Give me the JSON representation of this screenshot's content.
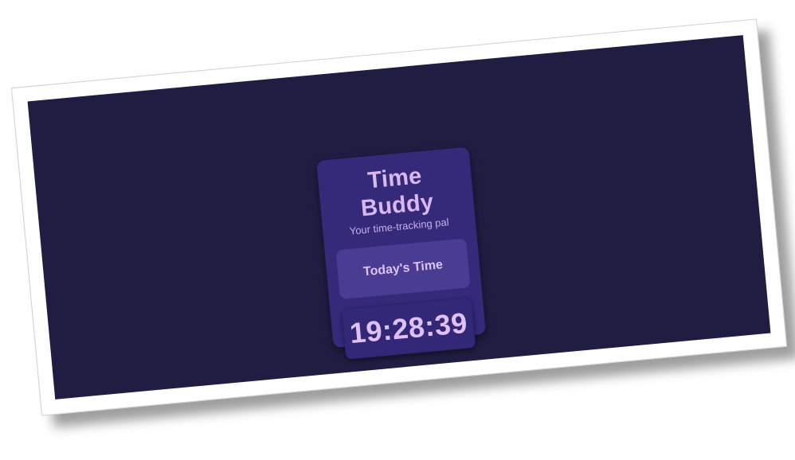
{
  "app": {
    "title": "Time Buddy",
    "subtitle": "Your time-tracking pal"
  },
  "today_section": {
    "label": "Today's Time"
  },
  "clock": {
    "time": "19:28:39"
  },
  "colors": {
    "background": "#1f1d42",
    "card": "#35297a",
    "panel": "#4a3c93",
    "text_accent": "#d9b8ef"
  }
}
